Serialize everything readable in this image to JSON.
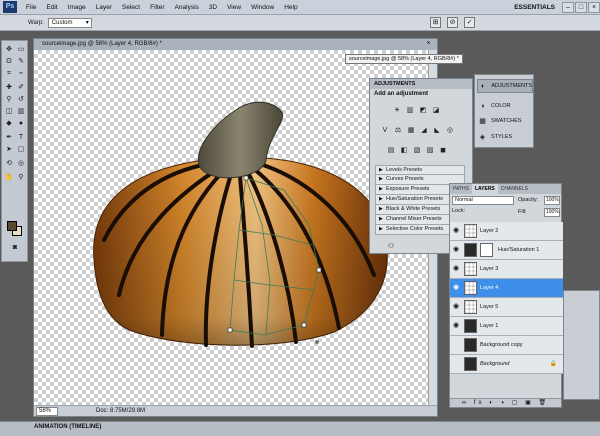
{
  "app": {
    "logo": "Ps",
    "menu": [
      "File",
      "Edit",
      "Image",
      "Layer",
      "Select",
      "Filter",
      "Analysis",
      "3D",
      "View",
      "Window",
      "Help"
    ],
    "workspace": "ESSENTIALS",
    "window_buttons": [
      "–",
      "□",
      "×"
    ]
  },
  "options": {
    "warp_label": "Warp:",
    "warp_value": "Custom",
    "icons": [
      "warp-toggle-icon",
      "cancel-icon",
      "commit-icon"
    ],
    "icon_glyphs": [
      "⊞",
      "⊘",
      "✓"
    ]
  },
  "document": {
    "title": "sourceimage.jpg @ 58% (Layer 4, RGB/8#) *",
    "tab_popup": "sourceimage.jpg @ 58% (Layer 4, RGB/8#) *",
    "zoom": "58%",
    "doc_info": "Doc: 8.75M/29.8M"
  },
  "adjustments": {
    "tab": "ADJUSTMENTS",
    "heading": "Add an adjustment",
    "row1": [
      "☀",
      "▥",
      "◩",
      "◪"
    ],
    "row2": [
      "V",
      "⚖",
      "▦",
      "◢",
      "◣",
      "◎"
    ],
    "row3": [
      "▤",
      "◧",
      "▧",
      "▨",
      "◼"
    ],
    "presets": [
      "Levels Presets",
      "Curves Presets",
      "Exposure Presets",
      "Hue/Saturation Presets",
      "Black & White Presets",
      "Channel Mixer Presets",
      "Selective Color Presets"
    ]
  },
  "dock": [
    {
      "label": "ADJUSTMENTS",
      "icon": "◐",
      "active": true
    },
    {
      "label": "COLOR",
      "icon": "◑",
      "active": false
    },
    {
      "label": "SWATCHES",
      "icon": "▦",
      "active": false
    },
    {
      "label": "STYLES",
      "icon": "◈",
      "active": false
    }
  ],
  "layers": {
    "tabs": [
      "PATHS",
      "LAYERS",
      "CHANNELS"
    ],
    "blend_mode": "Normal",
    "opacity_label": "Opacity:",
    "opacity": "100%",
    "lock_label": "Lock:",
    "fill_label": "Fill:",
    "fill": "100%",
    "footer": "∞ fx ◐ ◑ ▢ ▣ 🗑",
    "items": [
      {
        "name": "Layer 2",
        "thumb": "transparent",
        "mask": false,
        "active": false
      },
      {
        "name": "Hue/Saturation 1",
        "thumb": "dark",
        "mask": true,
        "active": false
      },
      {
        "name": "Layer 3",
        "thumb": "transparent",
        "mask": false,
        "active": false
      },
      {
        "name": "Layer 4",
        "thumb": "transparent",
        "mask": false,
        "active": true
      },
      {
        "name": "Layer 5",
        "thumb": "transparent",
        "mask": false,
        "active": false
      },
      {
        "name": "Layer 1",
        "thumb": "dark",
        "mask": false,
        "active": false
      },
      {
        "name": "Background copy",
        "thumb": "dark",
        "mask": false,
        "active": false
      },
      {
        "name": "Background",
        "thumb": "dark",
        "mask": false,
        "active": false,
        "locked": true
      }
    ]
  },
  "bottom": {
    "label": "ANIMATION (TIMELINE)"
  },
  "colors": {
    "accent": "#3d8fea",
    "pumpkin": "#c8761f",
    "stem": "#6e6a55"
  }
}
